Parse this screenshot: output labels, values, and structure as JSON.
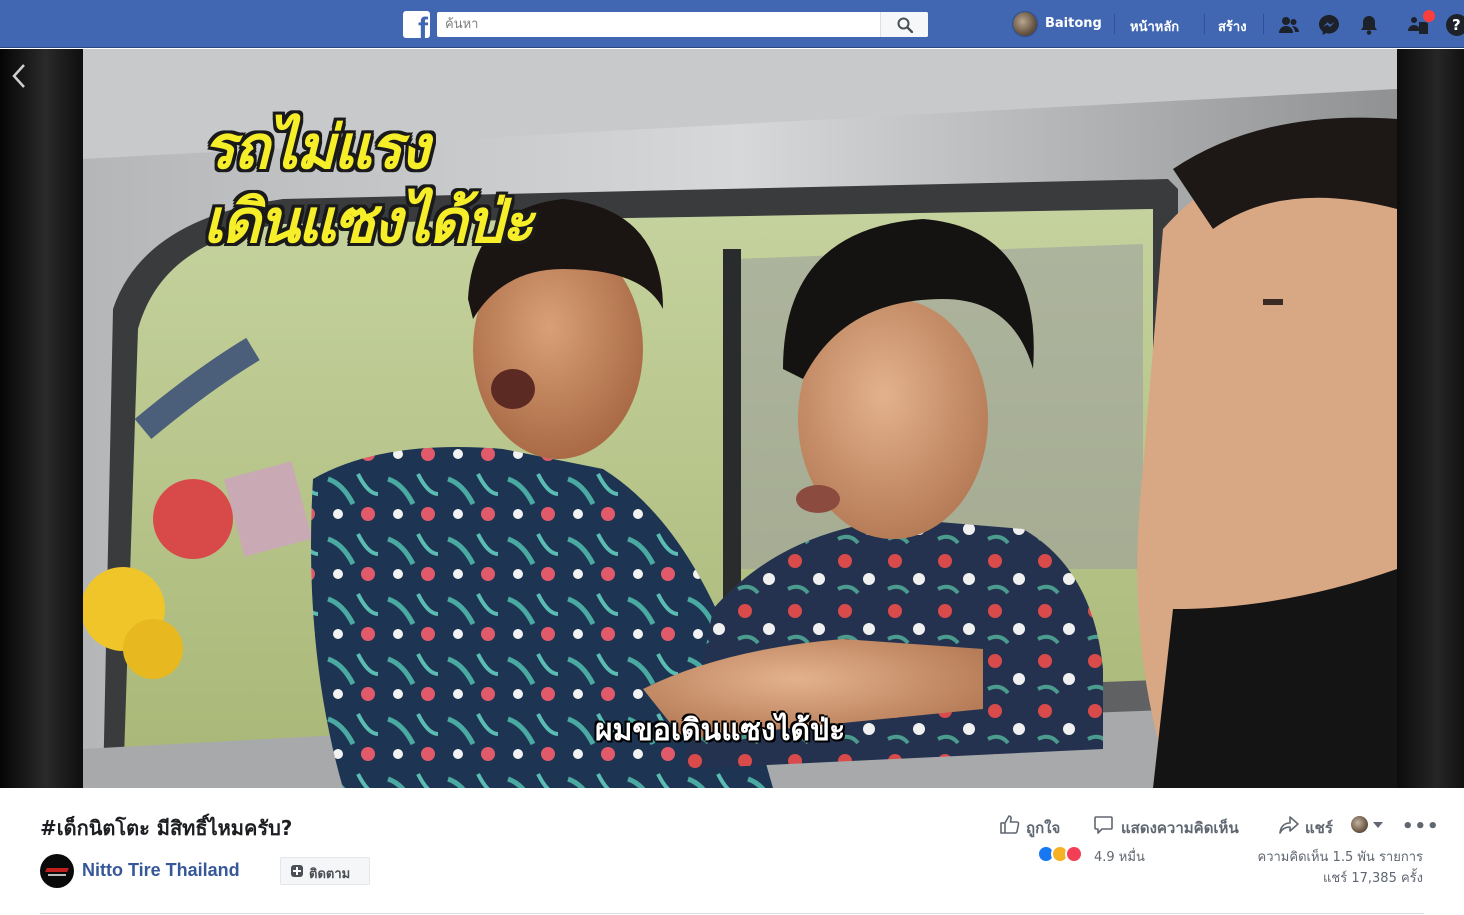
{
  "topbar": {
    "logo": "f",
    "search_placeholder": "ค้นหา",
    "profile_name": "Baitong",
    "nav": {
      "home": "หน้าหลัก",
      "create": "สร้าง"
    },
    "icons": [
      "friends-icon",
      "messenger-icon",
      "notifications-icon",
      "quick-help-icon",
      "help-icon"
    ],
    "help_glyph": "?",
    "accent_color": "#4267b2"
  },
  "video": {
    "overlay_title_line1": "รถไม่แรง",
    "overlay_title_line2": "เดินแซงได้ป่ะ",
    "subtitle": "ผมขอเดินแซงได้ป่ะ"
  },
  "post": {
    "title": "#เด็กนิตโตะ มีสิทธิ์ไหมครับ?",
    "page_name": "Nitto Tire Thailand",
    "follow_label": "ติดตาม",
    "actions": {
      "like": "ถูกใจ",
      "comment": "แสดงความคิดเห็น",
      "share": "แชร์"
    },
    "more": "•••",
    "reaction_count": "4.9 หมื่น",
    "comments_stat": "ความคิดเห็น 1.5 พัน รายการ",
    "shares_stat": "แชร์ 17,385 ครั้ง"
  }
}
